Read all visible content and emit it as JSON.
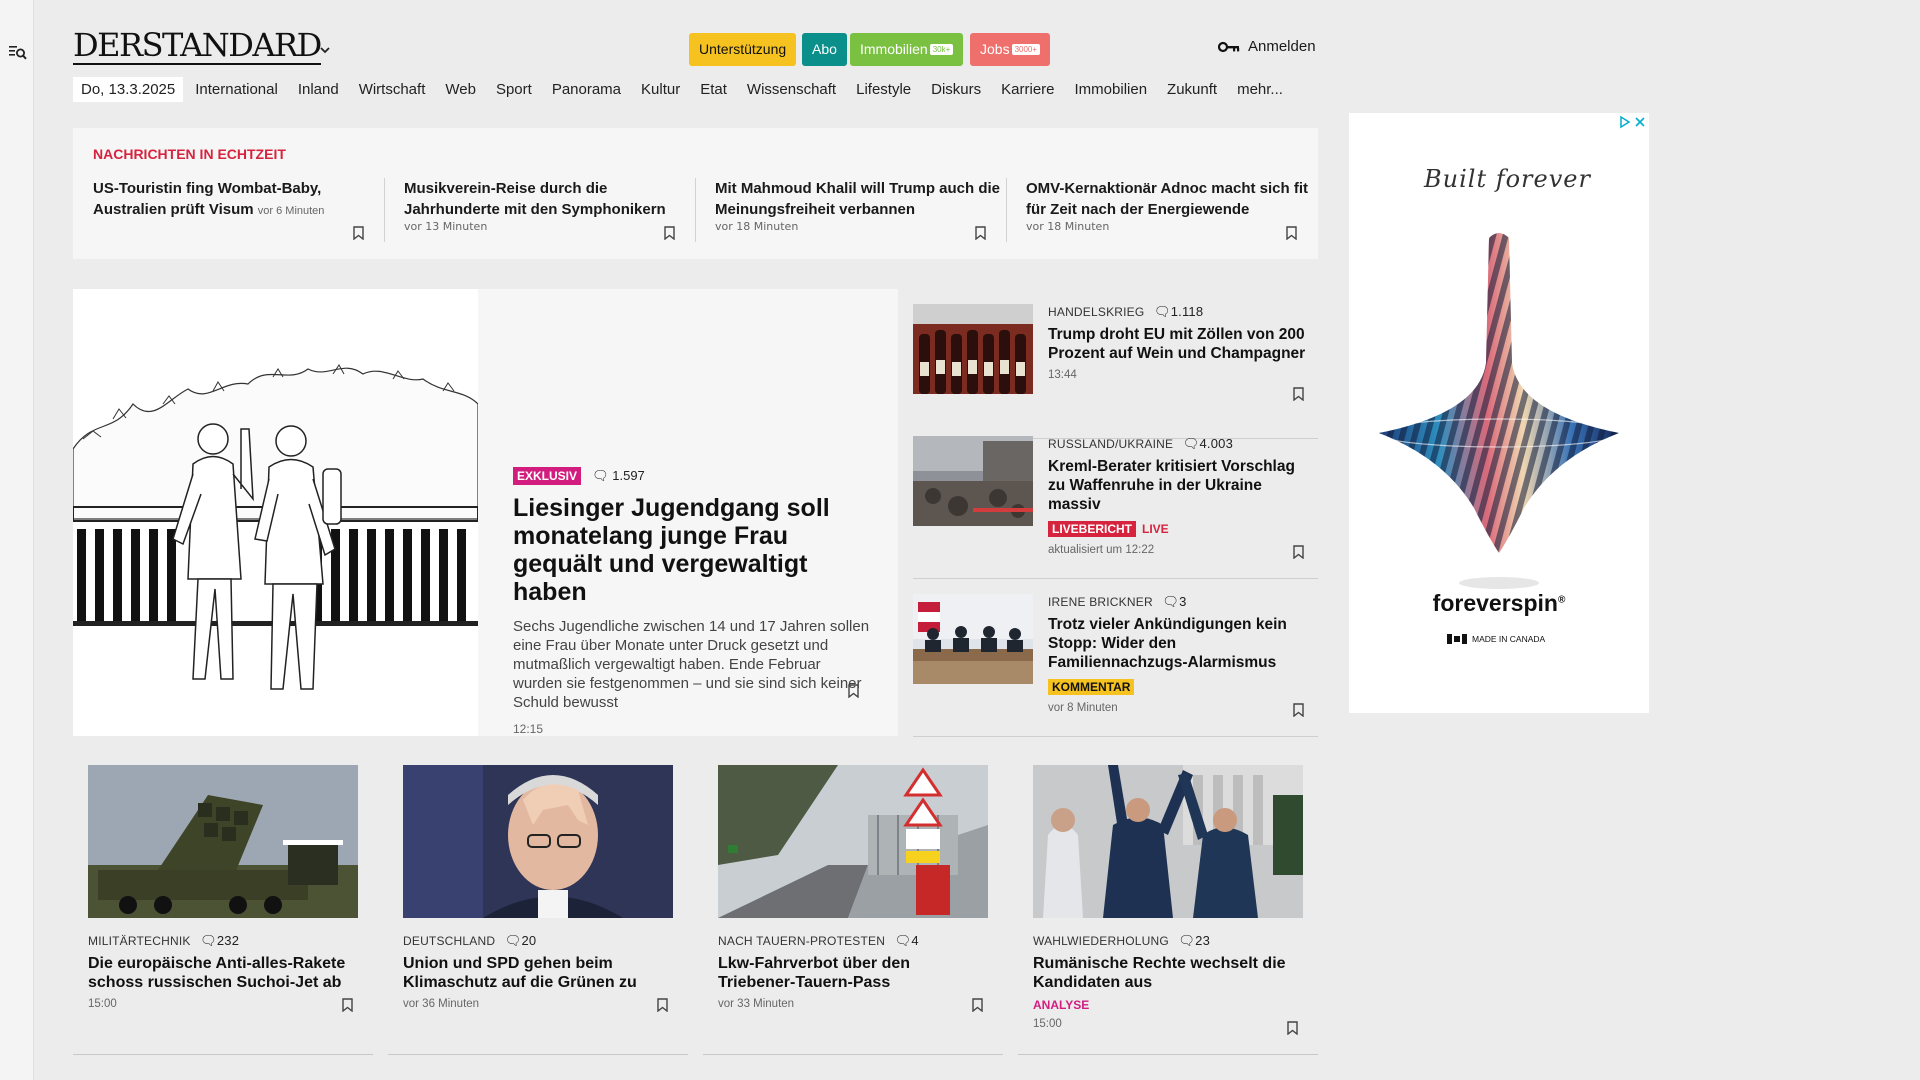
{
  "header": {
    "logo": "DERSTANDARD",
    "pills": [
      {
        "label": "Unterstützung",
        "bg": "#f6c21f",
        "fg": "#111111",
        "badge": ""
      },
      {
        "label": "Abo",
        "bg": "#0a8f8b",
        "fg": "#ffffff",
        "badge": ""
      },
      {
        "label": "Immobilien",
        "bg": "#7ac142",
        "fg": "#ffffff",
        "badge": "30k+"
      },
      {
        "label": "Jobs",
        "bg": "#ef6f6c",
        "fg": "#ffffff",
        "badge": "3000+"
      }
    ],
    "login_label": "Anmelden"
  },
  "nav": {
    "date": "Do, 13.3.2025",
    "items": [
      "International",
      "Inland",
      "Wirtschaft",
      "Web",
      "Sport",
      "Panorama",
      "Kultur",
      "Etat",
      "Wissenschaft",
      "Lifestyle",
      "Diskurs",
      "Karriere",
      "Immobilien",
      "Zukunft",
      "mehr..."
    ]
  },
  "ticker": {
    "title": "NACHRICHTEN IN ECHTZEIT",
    "items": [
      {
        "headline": "US-Touristin fing Wombat-Baby, Australien prüft Visum",
        "meta": "vor 6 Minuten"
      },
      {
        "headline": "Musikverein-Reise durch die Jahrhunderte mit den Symphonikern",
        "meta": "vor 13 Minuten"
      },
      {
        "headline": "Mit Mahmoud Khalil will Trump auch die Meinungsfreiheit verbannen",
        "meta": "vor 18 Minuten"
      },
      {
        "headline": "OMV-Kernaktionär Adnoc macht sich fit für Zeit nach der Energiewende",
        "meta": "vor 18 Minuten"
      }
    ]
  },
  "lead": {
    "tag": "EXKLUSIV",
    "comments": "1.597",
    "title": "Liesinger Jugendgang soll monatelang junge Frau gequält und vergewaltigt haben",
    "teaser": "Sechs Jugendliche zwischen 14 und 17 Jahren sollen eine Frau über Monate unter Druck gesetzt und mutmaßlich vergewaltigt haben. Ende Februar wurden sie festgenommen – und sie sind sich keiner Schuld bewusst",
    "time": "12:15"
  },
  "side": [
    {
      "kicker": "HANDELSKRIEG",
      "comments": "1.118",
      "title": "Trump droht EU mit Zöllen von 200 Prozent auf Wein und Champagner",
      "time": "13:44"
    },
    {
      "kicker": "RUSSLAND/UKRAINE",
      "comments": "4.003",
      "title": "Kreml-Berater kritisiert Vorschlag zu Waffenruhe in der Ukraine massiv",
      "tag": "LIVEBERICHT",
      "live": "LIVE",
      "time": "aktualisiert um 12:22"
    },
    {
      "kicker": "IRENE BRICKNER",
      "comments": "3",
      "title": "Trotz vieler Ankündigungen kein Stopp: Wider den Familiennachzugs-Alarmismus",
      "tag": "KOMMENTAR",
      "time": "vor 8 Minuten"
    }
  ],
  "ad": {
    "tagline": "Built forever",
    "brand": "foreverspin",
    "origin": "MADE IN CANADA"
  },
  "cards": [
    {
      "kicker": "MILITÄRTECHNIK",
      "comments": "232",
      "title": "Die europäische Anti-alles-Rakete schoss russischen Suchoi-Jet ab",
      "time": "15:00"
    },
    {
      "kicker": "DEUTSCHLAND",
      "comments": "20",
      "title": "Union und SPD gehen beim Klimaschutz auf die Grünen zu",
      "time": "vor 36 Minuten"
    },
    {
      "kicker": "NACH TAUERN-PROTESTEN",
      "comments": "4",
      "title": "Lkw-Fahrverbot über den Triebener-Tauern-Pass",
      "time": "vor 33 Minuten"
    },
    {
      "kicker": "WAHLWIEDERHOLUNG",
      "comments": "23",
      "title": "Rumänische Rechte wechselt die Kandidaten aus",
      "tag": "ANALYSE",
      "time": "15:00"
    }
  ]
}
